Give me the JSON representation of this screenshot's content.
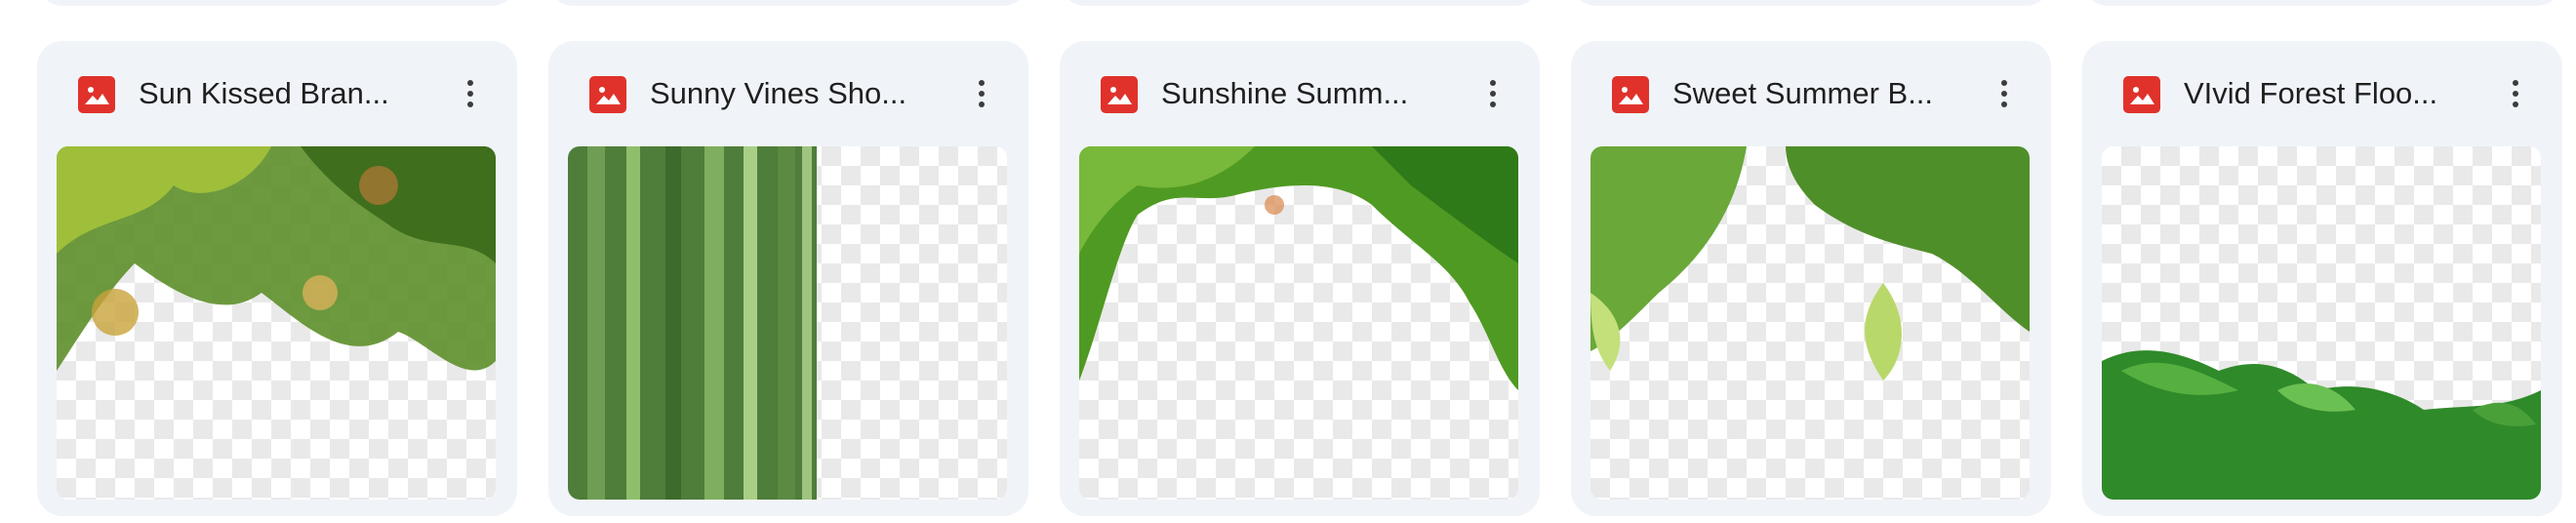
{
  "files": [
    {
      "name": "Sun Kissed Bran...",
      "type_icon": "image-file-icon"
    },
    {
      "name": "Sunny Vines Sho...",
      "type_icon": "image-file-icon"
    },
    {
      "name": "Sunshine Summ...",
      "type_icon": "image-file-icon"
    },
    {
      "name": "Sweet Summer B...",
      "type_icon": "image-file-icon"
    },
    {
      "name": "VIvid Forest Floo...",
      "type_icon": "image-file-icon"
    }
  ],
  "colors": {
    "card_background": "#f0f4f9",
    "image_icon": "#e0322b",
    "text": "#1f1f1f"
  }
}
